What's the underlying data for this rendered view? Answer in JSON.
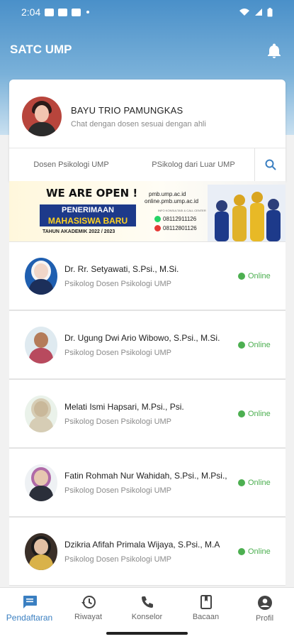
{
  "status_bar": {
    "time": "2:04"
  },
  "app": {
    "title": "SATC UMP"
  },
  "profile": {
    "name": "BAYU TRIO PAMUNGKAS",
    "subtitle": "Chat dengan dosen sesuai dengan ahli"
  },
  "tabs": [
    {
      "label": "Dosen Psikologi UMP"
    },
    {
      "label": "PSikolog dari Luar UMP"
    }
  ],
  "banner": {
    "headline": "WE ARE OPEN !",
    "line1": "PENERIMAAN",
    "line2": "MAHASISWA BARU",
    "year": "TAHUN AKADEMIK 2022 / 2023",
    "web1": "pmb.ump.ac.id",
    "web2": "online.pmb.ump.ac.id",
    "small": "INFO KONSULTASI & CALL CENTER",
    "phone1": "08112911126",
    "phone2": "08112801126"
  },
  "counselors": [
    {
      "name": "Dr. Rr. Setyawati, S.Psi., M.Si.",
      "role": "Psikolog Dosen Psikologi UMP",
      "status": "Online"
    },
    {
      "name": "Dr. Ugung Dwi Ario Wibowo, S.Psi., M.Si.",
      "role": "Psikolog Dosen Psikologi UMP",
      "status": "Online"
    },
    {
      "name": "Melati Ismi Hapsari, M.Psi., Psi.",
      "role": "Psikolog Dosen Psikologi UMP",
      "status": "Online"
    },
    {
      "name": "Fatin Rohmah Nur Wahidah, S.Psi., M.Psi.,",
      "role": "Psikolog Dosen Psikologi UMP",
      "status": "Online"
    },
    {
      "name": "Dzikria Afifah Primala Wijaya, S.Psi., M.A",
      "role": "Psikolog Dosen Psikologi UMP",
      "status": "Online"
    }
  ],
  "nav": [
    {
      "label": "Pendaftaran",
      "icon": "chat-icon"
    },
    {
      "label": "Riwayat",
      "icon": "history-icon"
    },
    {
      "label": "Konselor",
      "icon": "phone-icon"
    },
    {
      "label": "Bacaan",
      "icon": "book-icon"
    },
    {
      "label": "Profil",
      "icon": "account-icon"
    }
  ],
  "colors": {
    "accent": "#3a7fc1",
    "online": "#4caf50",
    "header": "#4a90c9"
  }
}
